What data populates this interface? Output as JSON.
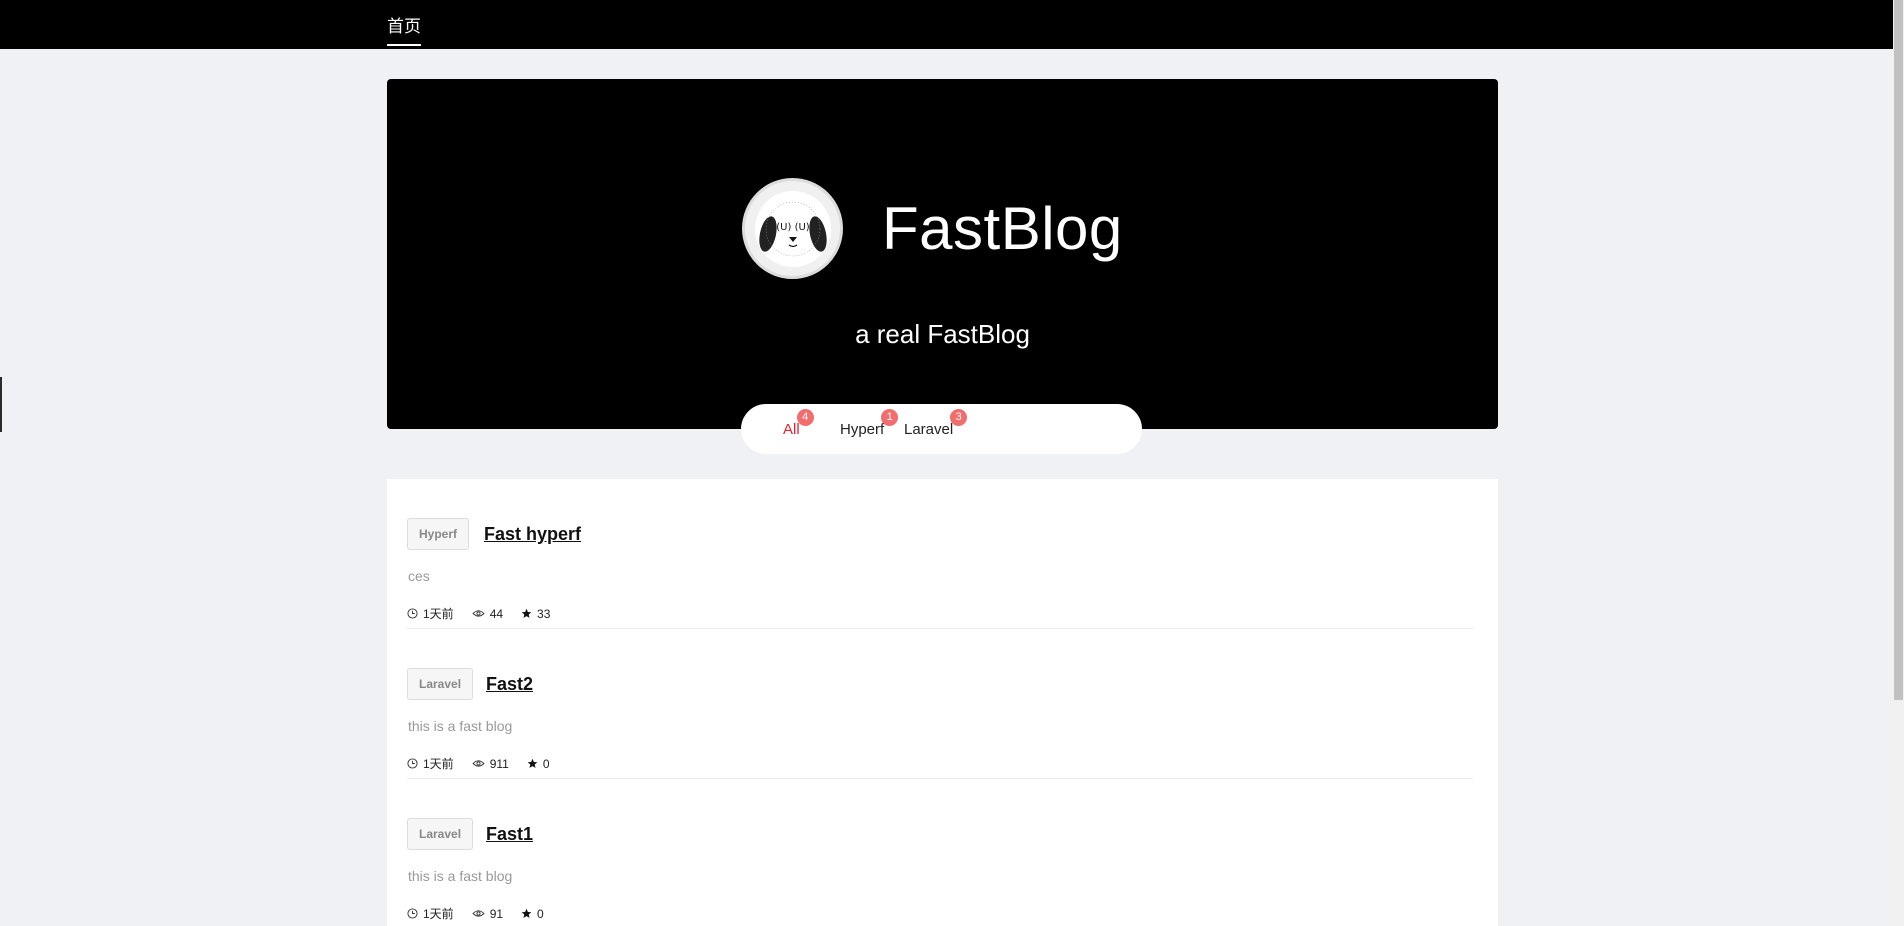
{
  "nav": {
    "home_label": "首页"
  },
  "hero": {
    "title": "FastBlog",
    "subtitle": "a real FastBlog"
  },
  "categories": [
    {
      "label": "All",
      "count": "4",
      "active": true
    },
    {
      "label": "Hyperf",
      "count": "1",
      "active": false
    },
    {
      "label": "Laravel",
      "count": "3",
      "active": false
    }
  ],
  "posts": [
    {
      "tag": "Hyperf",
      "title": "Fast hyperf",
      "excerpt": "ces",
      "time": "1天前",
      "views": "44",
      "stars": "33"
    },
    {
      "tag": "Laravel",
      "title": "Fast2",
      "excerpt": "this is a fast blog",
      "time": "1天前",
      "views": "911",
      "stars": "0"
    },
    {
      "tag": "Laravel",
      "title": "Fast1",
      "excerpt": "this is a fast blog",
      "time": "1天前",
      "views": "91",
      "stars": "0"
    }
  ],
  "colors": {
    "accent": "#e0262f",
    "badge": "#f26d6d",
    "header": "#000000",
    "page_bg": "#f0f1f5"
  },
  "icons": {
    "clock": "clock-icon",
    "views": "eye-icon",
    "stars": "star-icon"
  }
}
